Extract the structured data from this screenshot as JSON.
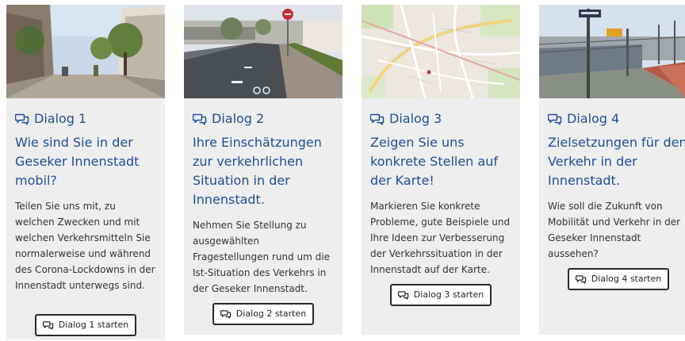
{
  "cards": [
    {
      "dialog_label": "Dialog 1",
      "title": "Wie sind Sie in der Geseker Innenstadt mobil?",
      "description": "Teilen Sie uns mit, zu welchen Zwecken und mit welchen Verkehrsmitteln Sie normalerweise und während des Corona-Lockdowns in der Innenstadt unterwegs sind.",
      "button_label": "Dialog 1 starten",
      "icon": "chat-bubbles-icon"
    },
    {
      "dialog_label": "Dialog 2",
      "title": "Ihre Einschätzungen zur verkehrlichen Situation in der Innenstadt.",
      "description": "Nehmen Sie Stellung zu ausgewählten Fragestellungen rund um die Ist-Situation des Verkehrs in der Geseker Innenstadt.",
      "button_label": "Dialog 2 starten",
      "icon": "chat-bubbles-icon"
    },
    {
      "dialog_label": "Dialog 3",
      "title": "Zeigen Sie uns konkrete Stellen auf der Karte!",
      "description": "Markieren Sie konkrete Probleme, gute Beispiele und Ihre Ideen zur Verbesserung der Verkehrssituation in der Innenstadt auf der Karte.",
      "button_label": "Dialog 3 starten",
      "icon": "chat-bubbles-icon"
    },
    {
      "dialog_label": "Dialog 4",
      "title": "Zielsetzungen für den Verkehr in der Innenstadt.",
      "description": "Wie soll die Zukunft von Mobilität und Verkehr in der Geseker Innenstadt aussehen?",
      "button_label": "Dialog 4 starten",
      "icon": "chat-bubbles-icon"
    }
  ],
  "colors": {
    "heading": "#1f4e96",
    "card_bg": "#eeeeee",
    "button_border": "#2a2a2a"
  }
}
